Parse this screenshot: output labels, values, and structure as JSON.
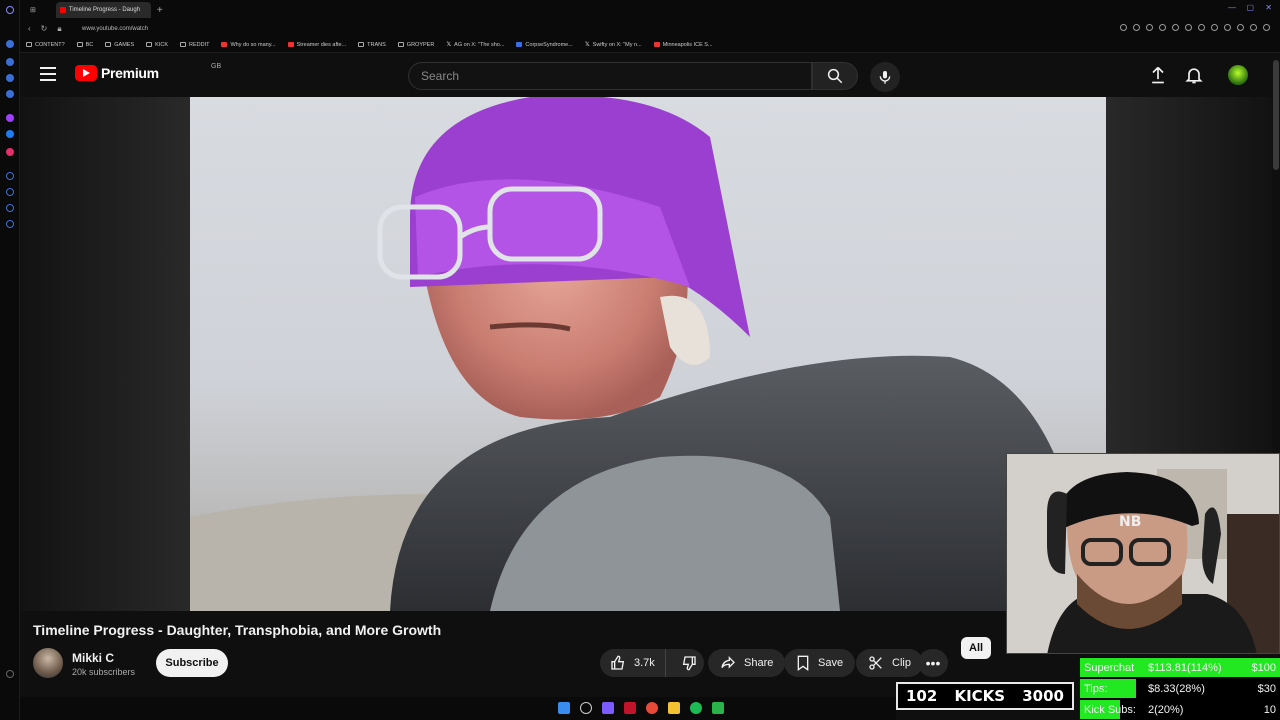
{
  "browser": {
    "tab_title": "Timeline Progress - Daugh",
    "tab_new": "+",
    "url": "www.youtube.com/watch",
    "bookmarks": [
      {
        "label": "CONTENT?",
        "icon": "folder-icon"
      },
      {
        "label": "BC",
        "icon": "folder-icon"
      },
      {
        "label": "GAMES",
        "icon": "folder-icon"
      },
      {
        "label": "KICK",
        "icon": "folder-icon"
      },
      {
        "label": "REDDIT",
        "icon": "folder-icon"
      },
      {
        "label": "Why do so many...",
        "icon": "youtube-icon"
      },
      {
        "label": "Streamer dies afte...",
        "icon": "youtube-icon"
      },
      {
        "label": "TRANS",
        "icon": "folder-icon"
      },
      {
        "label": "GROYPER",
        "icon": "folder-icon"
      },
      {
        "label": "AG on X: \"The sho...",
        "icon": "x-icon"
      },
      {
        "label": "CorpseSyndrome...",
        "icon": "site-icon"
      },
      {
        "label": "Swifty on X: \"My n...",
        "icon": "x-icon"
      },
      {
        "label": "Minneapolis ICE S...",
        "icon": "youtube-icon"
      }
    ]
  },
  "header": {
    "logo_text": "Premium",
    "country_code": "GB",
    "search_placeholder": "Search"
  },
  "video": {
    "title": "Timeline Progress - Daughter, Transphobia, and More Growth",
    "channel_name": "Mikki C",
    "channel_subs": "20k subscribers",
    "subscribe_label": "Subscribe",
    "like_count": "3.7k",
    "share_label": "Share",
    "save_label": "Save",
    "clip_label": "Clip",
    "more_label": "•••",
    "chip_all": "All"
  },
  "overlay": {
    "kicks_current": "102",
    "kicks_label": "KICKS",
    "kicks_goal": "3000",
    "stats": [
      {
        "label": "Superchat",
        "value": "$113.81(114%)",
        "goal": "$100",
        "fill": 1.0
      },
      {
        "label": "Tips:",
        "value": "$8.33(28%)",
        "goal": "$30",
        "fill": 0.28
      },
      {
        "label": "Kick Subs:",
        "value": "2(20%)",
        "goal": "10",
        "fill": 0.2
      }
    ]
  },
  "colors": {
    "youtube_red": "#ff0000",
    "stat_green": "#22e822",
    "background": "#0f0f0f"
  }
}
